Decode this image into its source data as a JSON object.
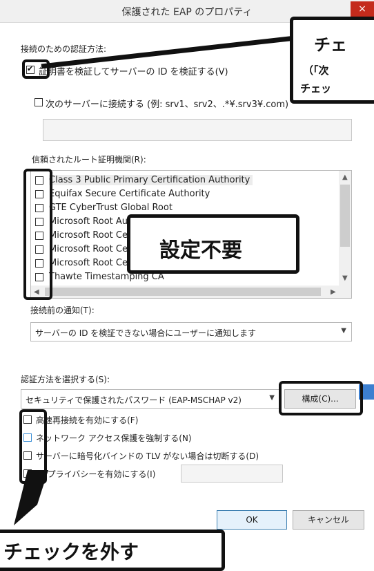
{
  "dialog": {
    "title": "保護された EAP のプロパティ",
    "close_icon": "×",
    "connect_auth_label": "接続のための認証方法:",
    "verify_cert": {
      "label": "証明書を検証してサーバーの ID を検証する(V)",
      "checked": true
    },
    "connect_servers": {
      "label": "次のサーバーに接続する (例: srv1、srv2、.*¥.srv3¥.com)",
      "checked": false,
      "value": ""
    },
    "trusted_roots_label": "信頼されたルート証明機関(R):",
    "trusted_roots": [
      "Class 3 Public Primary Certification Authority",
      "Equifax Secure Certificate Authority",
      "GTE CyberTrust Global Root",
      "Microsoft Root Authority",
      "Microsoft Root Certificate Authority",
      "Microsoft Root Certificate Authority 2010",
      "Microsoft Root Certificate Authority 2011",
      "Thawte Timestamping CA"
    ],
    "notify_label": "接続前の通知(T):",
    "notify_value": "サーバーの ID を検証できない場合にユーザーに通知します",
    "auth_method_label": "認証方法を選択する(S):",
    "auth_method_value": "セキュリティで保護されたパスワード (EAP-MSCHAP v2)",
    "configure_button": "構成(C)...",
    "options": [
      {
        "label": "高速再接続を有効にする(F)",
        "checked": false
      },
      {
        "label": "ネットワーク アクセス保護を強制する(N)",
        "checked": false
      },
      {
        "label": "サーバーに暗号化バインドの TLV がない場合は切断する(D)",
        "checked": false
      },
      {
        "label": "ID プライバシーを有効にする(I)",
        "checked": false
      }
    ],
    "identity_value": "",
    "ok_button": "OK",
    "cancel_button": "キャンセル"
  },
  "callouts": {
    "top_title": "チェ",
    "top_line1": "（「次",
    "top_line2": "チェッ",
    "middle": "設定不要",
    "bottom": "チェックを外す"
  }
}
